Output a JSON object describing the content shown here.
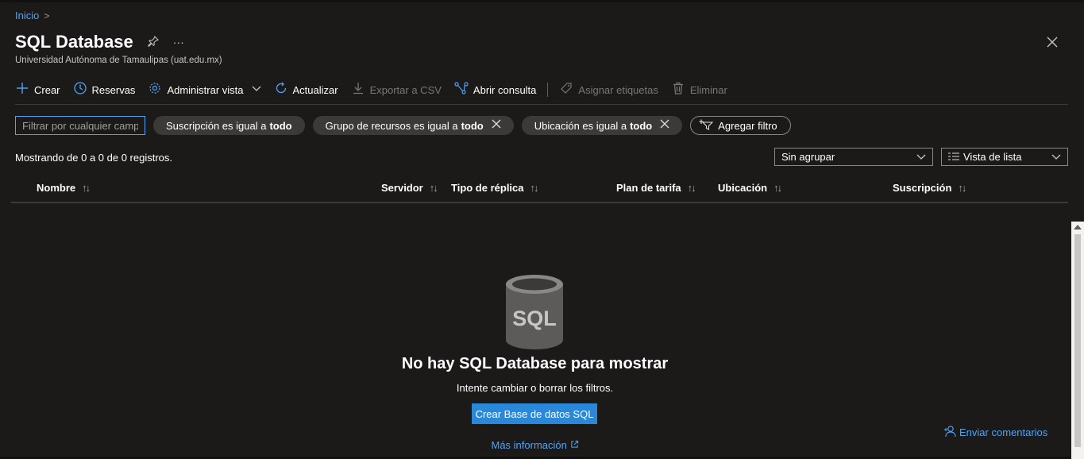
{
  "breadcrumb": {
    "home": "Inicio",
    "separator": ">"
  },
  "page": {
    "title": "SQL Database",
    "subtitle": "Universidad Autónoma de Tamaulipas (uat.edu.mx)",
    "pin_icon": "pin-icon",
    "more_icon": "ellipsis-icon",
    "close_icon": "close-icon"
  },
  "toolbar": {
    "create": "Crear",
    "reservations": "Reservas",
    "manage_view": "Administrar vista",
    "refresh": "Actualizar",
    "export_csv": "Exportar a CSV",
    "open_query": "Abrir consulta",
    "assign_tags": "Asignar etiquetas",
    "delete": "Eliminar"
  },
  "filters": {
    "search_placeholder": "Filtrar por cualquier campo...",
    "subscription": {
      "prefix": "Suscripción es igual a",
      "value": "todo"
    },
    "resource_group": {
      "prefix": "Grupo de recursos es igual a",
      "value": "todo"
    },
    "location": {
      "prefix": "Ubicación es igual a",
      "value": "todo"
    },
    "add_filter": "Agregar filtro"
  },
  "results": {
    "count_text": "Mostrando de 0 a 0 de 0 registros.",
    "grouping": "Sin agrupar",
    "view": "Vista de lista"
  },
  "table": {
    "columns": [
      "Nombre",
      "Servidor",
      "Tipo de réplica",
      "Plan de tarifa",
      "Ubicación",
      "Suscripción"
    ],
    "sort_glyph": "↑↓"
  },
  "empty_state": {
    "icon_label": "SQL",
    "title": "No hay SQL Database para mostrar",
    "subtitle": "Intente cambiar o borrar los filtros.",
    "create_button": "Crear Base de datos SQL",
    "more_info": "Más información"
  },
  "feedback": {
    "label": "Enviar comentarios"
  },
  "colors": {
    "background": "#1b1a19",
    "accent": "#4fa3f7",
    "primary_button": "#2b88d8",
    "pill": "#3b3a39"
  }
}
